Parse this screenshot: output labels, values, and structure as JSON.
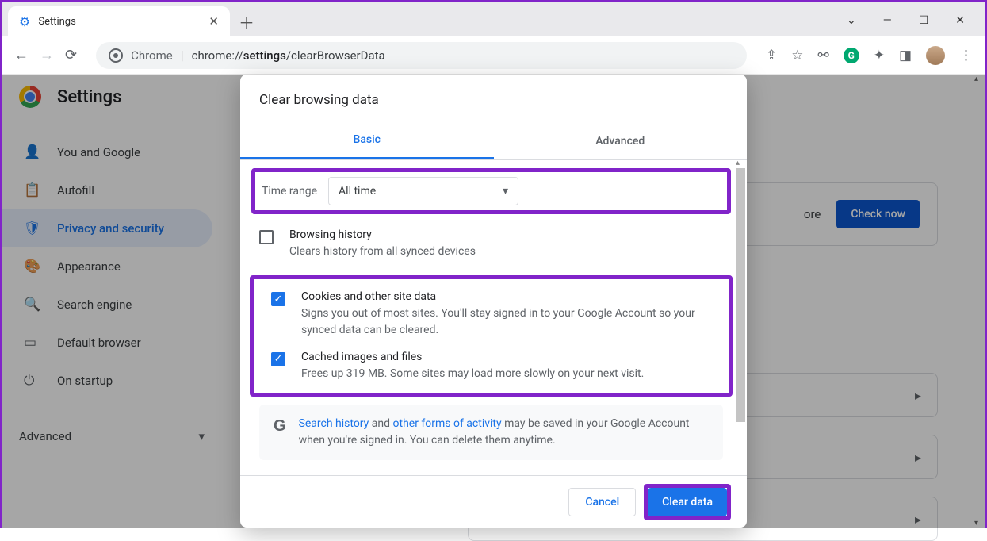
{
  "window": {
    "tab_title": "Settings"
  },
  "toolbar": {
    "product_label": "Chrome",
    "url_prefix": "chrome://",
    "url_bold": "settings",
    "url_rest": "/clearBrowserData"
  },
  "settings": {
    "title": "Settings",
    "sidebar": [
      {
        "icon": "person",
        "label": "You and Google"
      },
      {
        "icon": "autofill",
        "label": "Autofill"
      },
      {
        "icon": "shield",
        "label": "Privacy and security",
        "active": true
      },
      {
        "icon": "palette",
        "label": "Appearance"
      },
      {
        "icon": "search",
        "label": "Search engine"
      },
      {
        "icon": "browser",
        "label": "Default browser"
      },
      {
        "icon": "power",
        "label": "On startup"
      }
    ],
    "advanced_label": "Advanced",
    "bg_card": {
      "more_label": "ore",
      "button": "Check now"
    }
  },
  "dialog": {
    "title": "Clear browsing data",
    "tabs": {
      "basic": "Basic",
      "advanced": "Advanced",
      "active": "basic"
    },
    "time_range": {
      "label": "Time range",
      "value": "All time"
    },
    "items": [
      {
        "title": "Browsing history",
        "desc": "Clears history from all synced devices",
        "checked": false
      },
      {
        "title": "Cookies and other site data",
        "desc": "Signs you out of most sites. You'll stay signed in to your Google Account so your synced data can be cleared.",
        "checked": true
      },
      {
        "title": "Cached images and files",
        "desc": "Frees up 319 MB. Some sites may load more slowly on your next visit.",
        "checked": true
      }
    ],
    "info": {
      "link1": "Search history",
      "mid": " and ",
      "link2": "other forms of activity",
      "rest": " may be saved in your Google Account when you're signed in. You can delete them anytime."
    },
    "buttons": {
      "cancel": "Cancel",
      "clear": "Clear data"
    }
  }
}
